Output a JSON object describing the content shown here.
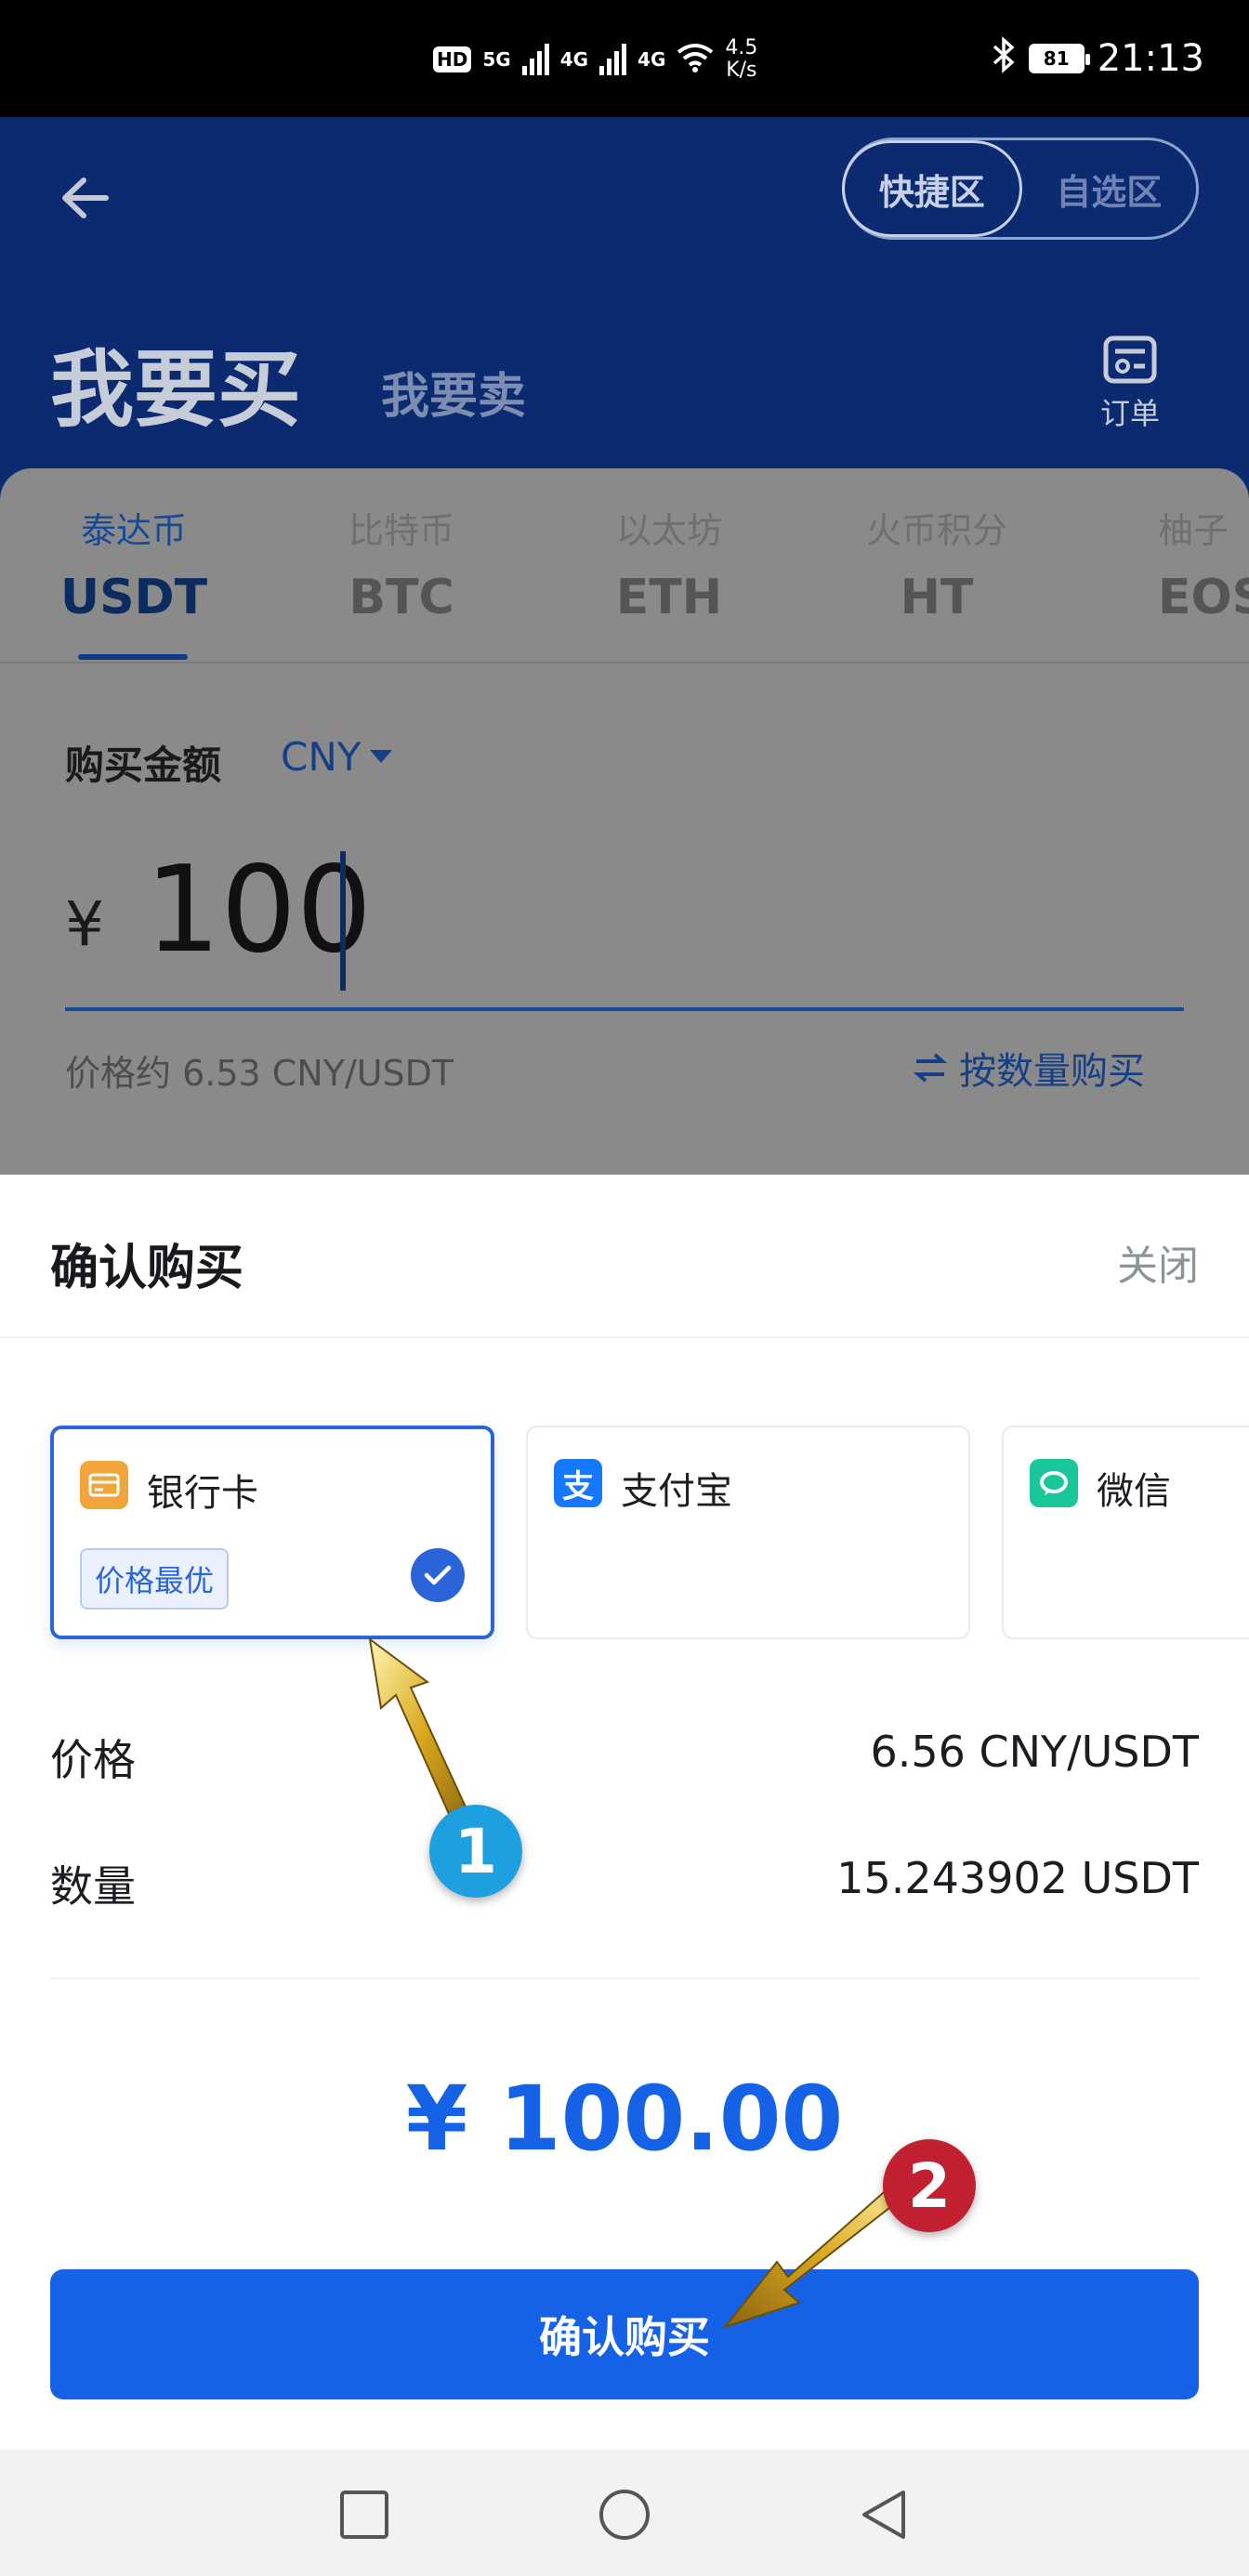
{
  "status_bar": {
    "hd": "HD",
    "net_5g": "5G",
    "net_4g": "4G",
    "net_4g2": "4G",
    "speed_value": "4.5",
    "speed_unit": "K/s",
    "battery": "81",
    "time": "21:13"
  },
  "header": {
    "zone_quick": "快捷区",
    "zone_custom": "自选区",
    "buy_title": "我要买",
    "sell_title": "我要卖",
    "orders_label": "订单"
  },
  "coins": [
    {
      "cn": "泰达币",
      "code": "USDT",
      "active": true
    },
    {
      "cn": "比特币",
      "code": "BTC",
      "active": false
    },
    {
      "cn": "以太坊",
      "code": "ETH",
      "active": false
    },
    {
      "cn": "火币积分",
      "code": "HT",
      "active": false
    },
    {
      "cn": "柚子",
      "code": "EOS",
      "active": false
    }
  ],
  "buy_form": {
    "amount_label": "购买金额",
    "currency": "CNY",
    "yen": "¥",
    "amount": "100",
    "price_approx": "价格约 6.53 CNY/USDT",
    "by_quantity": "按数量购买"
  },
  "sheet": {
    "title": "确认购买",
    "close": "关闭",
    "payments": [
      {
        "name": "银行卡",
        "icon": "bank-card-icon",
        "badge": "价格最优",
        "selected": true,
        "color": "#f0a43a"
      },
      {
        "name": "支付宝",
        "icon": "alipay-icon",
        "glyph": "支",
        "selected": false,
        "color": "#1677ff"
      },
      {
        "name": "微信",
        "icon": "wechat-icon",
        "selected": false,
        "color": "#19c79a"
      }
    ],
    "price_label": "价格",
    "price_value": "6.56 CNY/USDT",
    "qty_label": "数量",
    "qty_value": "15.243902 USDT",
    "total": "¥ 100.00",
    "confirm": "确认购买"
  },
  "annotations": {
    "step1": "1",
    "step2": "2"
  },
  "colors": {
    "header_bg": "#0b2a6f",
    "accent": "#1662e6",
    "selected_border": "#2a64d8"
  }
}
